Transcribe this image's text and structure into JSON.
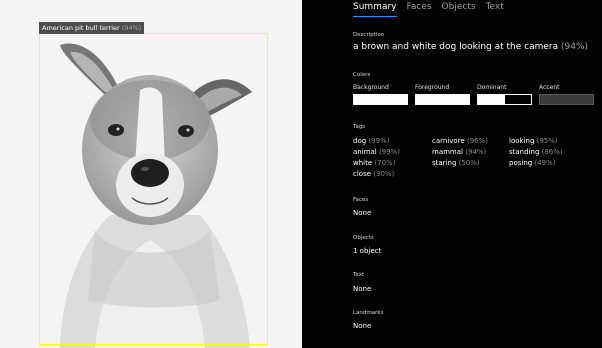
{
  "image": {
    "detected_object": {
      "label": "American pit bull terrier",
      "confidence": "(94%)"
    }
  },
  "tabs": [
    {
      "label": "Summary"
    },
    {
      "label": "Faces"
    },
    {
      "label": "Objects"
    },
    {
      "label": "Text"
    }
  ],
  "description": {
    "heading": "Description",
    "caption": "a brown and white dog looking at the camera",
    "confidence": "(94%)"
  },
  "colors": {
    "heading": "Colors",
    "items": [
      {
        "name": "Background",
        "swatch": "#ffffff"
      },
      {
        "name": "Foreground",
        "swatch": "#ffffff"
      },
      {
        "name": "Dominant",
        "swatch": "#ffffff/#000000"
      },
      {
        "name": "Accent",
        "swatch": "#3b3b3b"
      }
    ]
  },
  "tags": {
    "heading": "Tags",
    "columns": [
      [
        {
          "name": "dog",
          "confidence": "(99%)"
        },
        {
          "name": "animal",
          "confidence": "(99%)"
        },
        {
          "name": "white",
          "confidence": "(70%)"
        },
        {
          "name": "close",
          "confidence": "(30%)"
        }
      ],
      [
        {
          "name": "carnivore",
          "confidence": "(96%)"
        },
        {
          "name": "mammal",
          "confidence": "(94%)"
        },
        {
          "name": "staring",
          "confidence": "(50%)"
        }
      ],
      [
        {
          "name": "looking",
          "confidence": "(95%)"
        },
        {
          "name": "standing",
          "confidence": "(86%)"
        },
        {
          "name": "posing",
          "confidence": "(49%)"
        }
      ]
    ]
  },
  "faces": {
    "heading": "Faces",
    "value": "None"
  },
  "objects": {
    "heading": "Objects",
    "value": "1 object"
  },
  "text": {
    "heading": "Text",
    "value": "None"
  },
  "landmarks": {
    "heading": "Landmarks",
    "value": "None"
  }
}
